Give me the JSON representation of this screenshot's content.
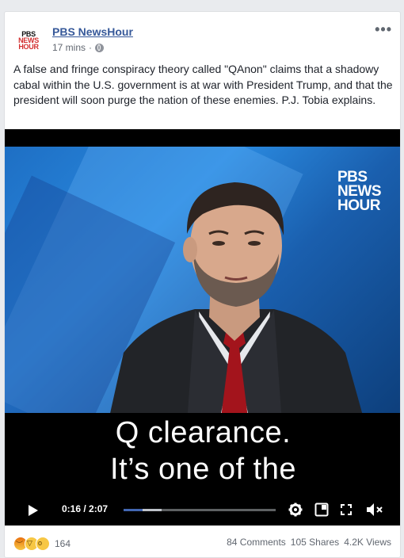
{
  "post": {
    "page_name": "PBS NewsHour",
    "time": "17 mins",
    "separator": "·",
    "more_label": "•••",
    "logo": {
      "line1": "PBS",
      "line2": "NEWS",
      "line3": "HOUR"
    },
    "text": "A false and fringe conspiracy theory called \"QAnon\" claims that a shadowy cabal within the U.S. government is at war with President Trump, and that the president will soon purge the nation of these enemies. P.J. Tobia explains."
  },
  "video": {
    "bug": {
      "line1": "PBS",
      "line2": "NEWS",
      "line3": "HOUR"
    },
    "caption_line1": "Q clearance.",
    "caption_line2": "It’s one of the",
    "time_display": "0:16 / 2:07",
    "progress_played_fraction": 0.126,
    "progress_buffered_fraction": 0.25,
    "accent_color": "#4267b2"
  },
  "footer": {
    "reaction_count": "164",
    "reactions": [
      "angry-icon",
      "haha-icon",
      "wow-icon"
    ],
    "comments": "84 Comments",
    "shares": "105 Shares",
    "views": "4.2K Views"
  }
}
